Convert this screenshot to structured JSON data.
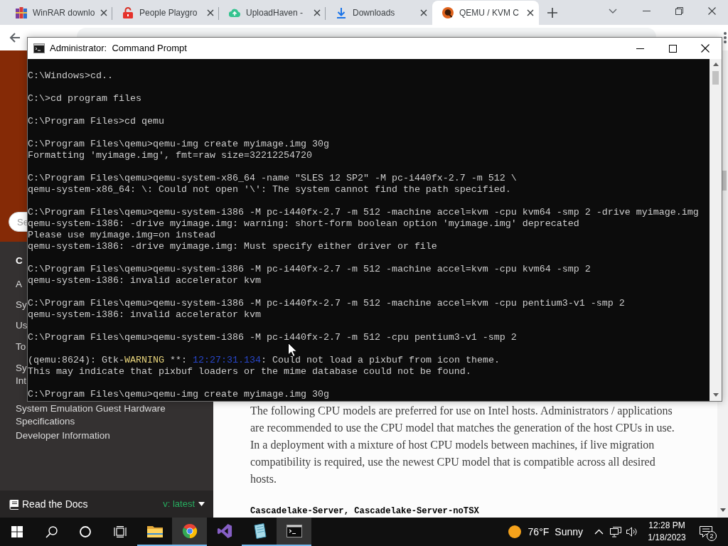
{
  "browser": {
    "tabs": [
      {
        "title": "WinRAR downlo",
        "selected": false
      },
      {
        "title": "People Playgro",
        "selected": false
      },
      {
        "title": "UploadHaven -",
        "selected": false
      },
      {
        "title": "Downloads",
        "selected": false
      },
      {
        "title": "QEMU / KVM C",
        "selected": true
      }
    ]
  },
  "docs_sidebar": {
    "search": {
      "placeholder": "Se"
    },
    "caption": "C",
    "items": [
      {
        "lines": [
          "A"
        ]
      },
      {
        "lines": [
          "Sy"
        ]
      },
      {
        "lines": [
          "Us"
        ]
      },
      {
        "lines": [
          "To"
        ]
      },
      {
        "lines": [
          "Sy",
          "Int"
        ]
      },
      {
        "lines": [
          "System Emulation Guest Hardware Specifications"
        ]
      },
      {
        "lines": [
          "Developer Information"
        ]
      }
    ],
    "footer": {
      "brand": "Read the Docs",
      "version": "v: latest"
    }
  },
  "docs_content": {
    "paragraph": "The following CPU models are preferred for use on Intel hosts. Administrators / applications are recommended to use the CPU model that matches the generation of the host CPUs in use. In a deployment with a mixture of host CPU models between machines, if live migration compatibility is required, use the newest CPU model that is compatible across all desired hosts.",
    "code": "Cascadelake-Server, Cascadelake-Server-noTSX"
  },
  "command_prompt": {
    "title": "Administrator:  Command Prompt",
    "blocks": [
      [
        "C:\\Windows>cd.."
      ],
      [
        "C:\\>cd program files"
      ],
      [
        "C:\\Program Files>cd qemu"
      ],
      [
        "C:\\Program Files\\qemu>qemu-img create myimage.img 30g",
        "Formatting 'myimage.img', fmt=raw size=32212254720"
      ],
      [
        "C:\\Program Files\\qemu>qemu-system-x86_64 -name \"SLES 12 SP2\" -M pc-i440fx-2.7 -m 512 \\",
        "qemu-system-x86_64: \\: Could not open '\\': The system cannot find the path specified."
      ],
      [
        "C:\\Program Files\\qemu>qemu-system-i386 -M pc-i440fx-2.7 -m 512 -machine accel=kvm -cpu kvm64 -smp 2 -drive myimage.img",
        "qemu-system-i386: -drive myimage.img: warning: short-form boolean option 'myimage.img' deprecated",
        "Please use myimage.img=on instead",
        "qemu-system-i386: -drive myimage.img: Must specify either driver or file"
      ],
      [
        "C:\\Program Files\\qemu>qemu-system-i386 -M pc-i440fx-2.7 -m 512 -machine accel=kvm -cpu kvm64 -smp 2",
        "qemu-system-i386: invalid accelerator kvm"
      ],
      [
        "C:\\Program Files\\qemu>qemu-system-i386 -M pc-i440fx-2.7 -m 512 -machine accel=kvm -cpu pentium3-v1 -smp 2",
        "qemu-system-i386: invalid accelerator kvm"
      ],
      [
        "C:\\Program Files\\qemu>qemu-system-i386 -M pc-i440fx-2.7 -m 512 -cpu pentium3-v1 -smp 2"
      ],
      [
        [
          {
            "text": "(qemu:8624): Gtk-"
          },
          {
            "text": "WARNING",
            "color": "#e5d27a"
          },
          {
            "text": " **: "
          },
          {
            "text": "12:27:31.134",
            "color": "#2846c8"
          },
          {
            "text": ": Could not load a pixbuf from icon theme."
          }
        ],
        "This may indicate that pixbuf loaders or the mime database could not be found."
      ],
      [
        "C:\\Program Files\\qemu>qemu-img create myimage.img 30g"
      ]
    ]
  },
  "taskbar": {
    "apps": [
      {
        "running": true,
        "highlighted": false
      },
      {
        "running": true,
        "highlighted": true
      },
      {
        "running": false,
        "highlighted": false
      },
      {
        "running": true,
        "highlighted": false
      },
      {
        "running": true,
        "highlighted": true
      }
    ],
    "weather": {
      "temperature": "76°F",
      "condition": "Sunny"
    },
    "clock": {
      "time": "12:28 PM",
      "date": "1/18/2023"
    },
    "notification_count": "2"
  }
}
